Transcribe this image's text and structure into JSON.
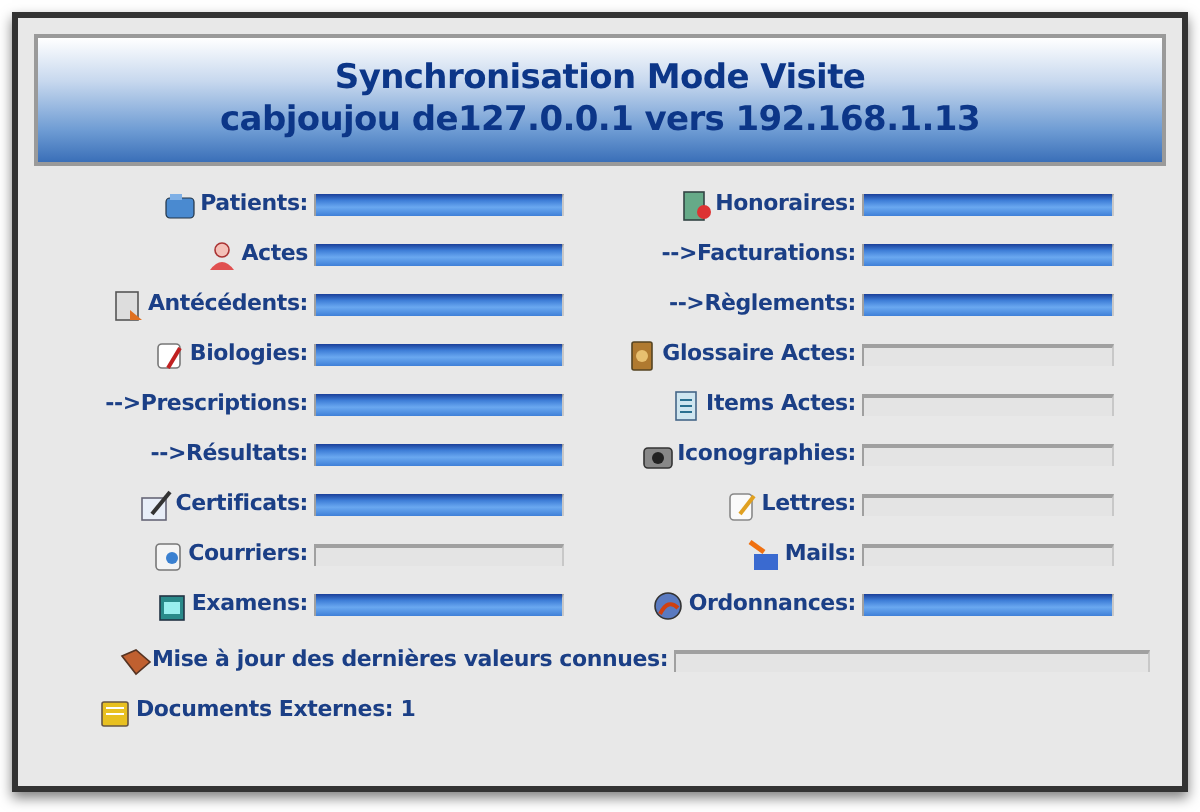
{
  "header": {
    "title": "Synchronisation Mode Visite",
    "subtitle": "cabjoujou de127.0.0.1 vers 192.168.1.13"
  },
  "left_rows": [
    {
      "kind": "icon",
      "label": "Patients:",
      "level": 1
    },
    {
      "kind": "icon",
      "label": "Actes",
      "level": 1
    },
    {
      "kind": "icon",
      "label": "Antécédents:",
      "level": 1
    },
    {
      "kind": "icon",
      "label": "Biologies:",
      "level": 1
    },
    {
      "kind": "sub",
      "label": "-->Prescriptions:",
      "level": 1
    },
    {
      "kind": "sub",
      "label": "-->Résultats:",
      "level": 1
    },
    {
      "kind": "icon",
      "label": "Certificats:",
      "level": 1
    },
    {
      "kind": "icon",
      "label": "Courriers:",
      "level": 0
    },
    {
      "kind": "icon",
      "label": "Examens:",
      "level": 1
    }
  ],
  "right_rows": [
    {
      "kind": "icon",
      "label": "Honoraires:",
      "level": 1
    },
    {
      "kind": "sub",
      "label": "-->Facturations:",
      "level": 1
    },
    {
      "kind": "sub",
      "label": "-->Règlements:",
      "level": 1
    },
    {
      "kind": "icon",
      "label": "Glossaire Actes:",
      "level": 0
    },
    {
      "kind": "icon",
      "label": "Items Actes:",
      "level": 0
    },
    {
      "kind": "icon",
      "label": "Iconographies:",
      "level": 0
    },
    {
      "kind": "icon",
      "label": "Lettres:",
      "level": 0
    },
    {
      "kind": "icon",
      "label": "Mails:",
      "level": 0
    },
    {
      "kind": "icon",
      "label": "Ordonnances:",
      "level": 1
    }
  ],
  "update_row": {
    "label": "Mise à jour des dernières valeurs connues:",
    "level": 0
  },
  "external_documents": "Documents Externes: 1"
}
